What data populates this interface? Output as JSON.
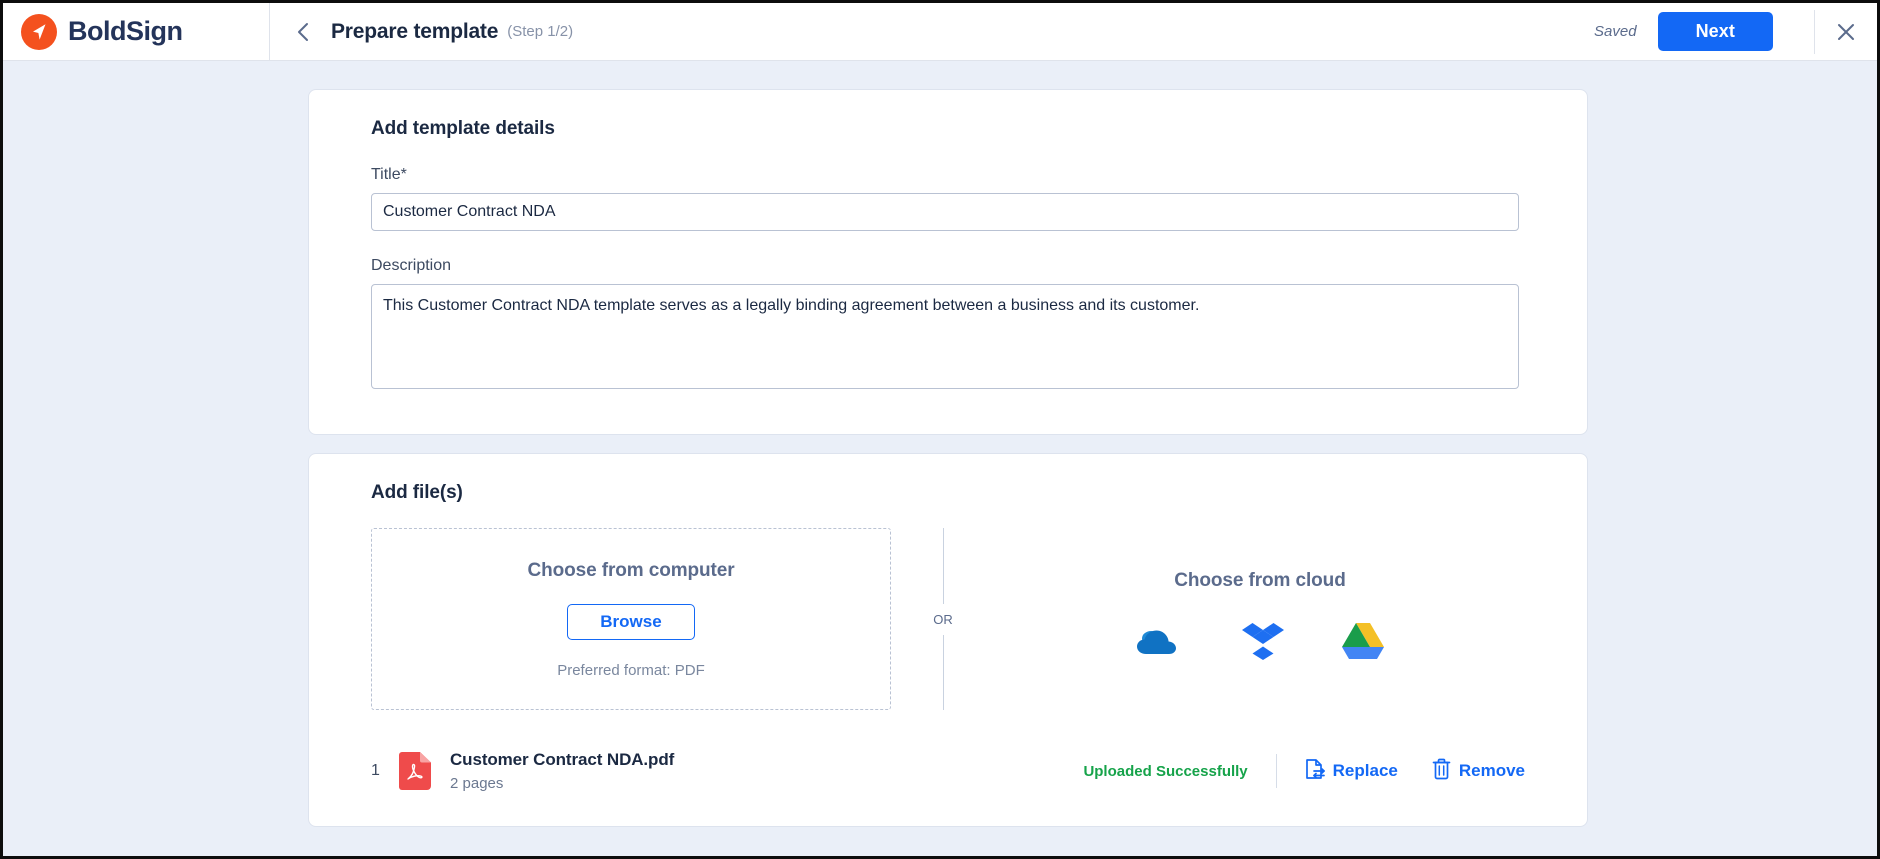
{
  "header": {
    "brand_name": "BoldSign",
    "brand_icon": "boldsign-logo-icon",
    "back_icon": "chevron-left-icon",
    "page_title": "Prepare template",
    "step_label": "(Step 1/2)",
    "saved_text": "Saved",
    "next_label": "Next",
    "close_icon": "close-icon",
    "accent_color": "#1368f5",
    "brand_color": "#f4511e"
  },
  "details_card": {
    "heading": "Add template details",
    "title_label": "Title*",
    "title_value": "Customer Contract NDA",
    "title_placeholder": "Title",
    "description_label": "Description",
    "description_value": "This Customer Contract NDA template serves as a legally binding agreement between a business and its customer.",
    "description_placeholder": "Description"
  },
  "files_card": {
    "heading": "Add file(s)",
    "dropzone": {
      "title": "Choose from computer",
      "browse_label": "Browse",
      "preferred_text": "Preferred format: PDF"
    },
    "or_text": "OR",
    "cloud": {
      "title": "Choose from cloud",
      "providers": [
        {
          "name": "onedrive-icon",
          "label": "OneDrive",
          "color": "#0f7cd0"
        },
        {
          "name": "dropbox-icon",
          "label": "Dropbox",
          "color": "#1e6ff1"
        },
        {
          "name": "googledrive-icon",
          "label": "Google Drive",
          "color": "#1a9d4b"
        }
      ]
    },
    "file": {
      "index": "1",
      "icon": "pdf-file-icon",
      "icon_color": "#ef4b4b",
      "name": "Customer Contract NDA.pdf",
      "pages": "2 pages",
      "status": "Uploaded Successfully",
      "status_color": "#16a34a",
      "replace_label": "Replace",
      "replace_icon": "replace-file-icon",
      "remove_label": "Remove",
      "remove_icon": "trash-icon"
    }
  }
}
